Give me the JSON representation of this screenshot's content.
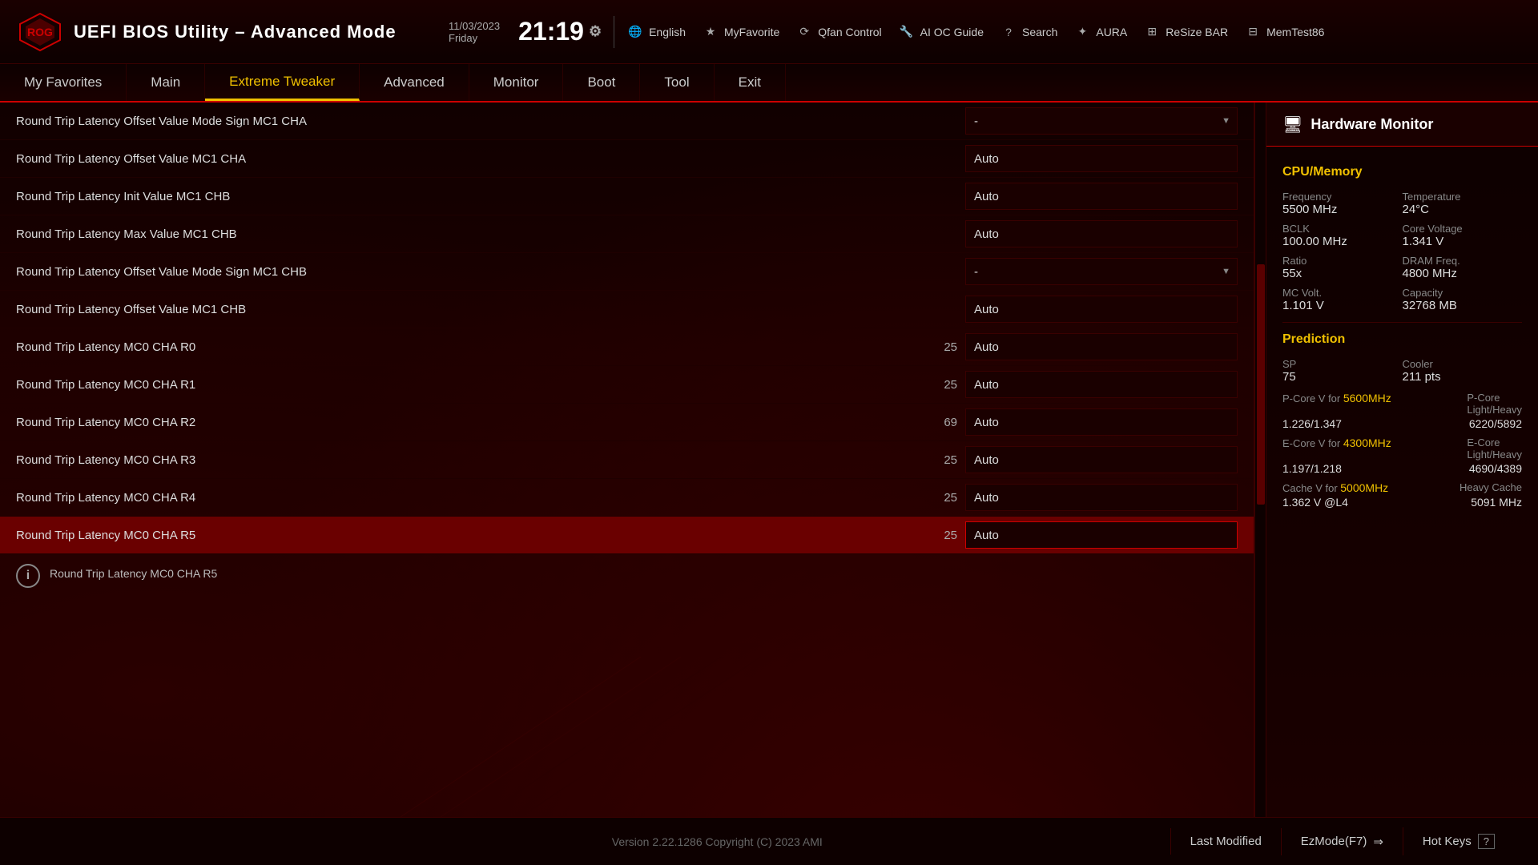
{
  "header": {
    "logo_text": "ROG",
    "title": "UEFI BIOS Utility – Advanced Mode",
    "date": "11/03/2023",
    "day": "Friday",
    "time": "21:19",
    "gear_symbol": "⚙",
    "toolbar": [
      {
        "id": "english",
        "icon": "🌐",
        "label": "English"
      },
      {
        "id": "myfavorite",
        "icon": "★",
        "label": "MyFavorite"
      },
      {
        "id": "qfan",
        "icon": "⟳",
        "label": "Qfan Control"
      },
      {
        "id": "aioc",
        "icon": "🔧",
        "label": "AI OC Guide"
      },
      {
        "id": "search",
        "icon": "?",
        "label": "Search"
      },
      {
        "id": "aura",
        "icon": "✦",
        "label": "AURA"
      },
      {
        "id": "resizebar",
        "icon": "⊞",
        "label": "ReSize BAR"
      },
      {
        "id": "memtest",
        "icon": "⊟",
        "label": "MemTest86"
      }
    ]
  },
  "nav": {
    "items": [
      {
        "id": "favorites",
        "label": "My Favorites"
      },
      {
        "id": "main",
        "label": "Main"
      },
      {
        "id": "tweaker",
        "label": "Extreme Tweaker",
        "active": true
      },
      {
        "id": "advanced",
        "label": "Advanced"
      },
      {
        "id": "monitor",
        "label": "Monitor"
      },
      {
        "id": "boot",
        "label": "Boot"
      },
      {
        "id": "tool",
        "label": "Tool"
      },
      {
        "id": "exit",
        "label": "Exit"
      }
    ]
  },
  "settings": {
    "rows": [
      {
        "id": "row1",
        "label": "Round Trip Latency Offset Value Mode Sign MC1 CHA",
        "number": null,
        "value": "-",
        "type": "dropdown",
        "active": false
      },
      {
        "id": "row2",
        "label": "Round Trip Latency Offset Value MC1 CHA",
        "number": null,
        "value": "Auto",
        "type": "text",
        "active": false
      },
      {
        "id": "row3",
        "label": "Round Trip Latency Init Value MC1 CHB",
        "number": null,
        "value": "Auto",
        "type": "text",
        "active": false
      },
      {
        "id": "row4",
        "label": "Round Trip Latency Max Value MC1 CHB",
        "number": null,
        "value": "Auto",
        "type": "text",
        "active": false
      },
      {
        "id": "row5",
        "label": "Round Trip Latency Offset Value Mode Sign MC1 CHB",
        "number": null,
        "value": "-",
        "type": "dropdown",
        "active": false
      },
      {
        "id": "row6",
        "label": "Round Trip Latency Offset Value MC1 CHB",
        "number": null,
        "value": "Auto",
        "type": "text",
        "active": false
      },
      {
        "id": "row7",
        "label": "Round Trip Latency MC0 CHA R0",
        "number": "25",
        "value": "Auto",
        "type": "text",
        "active": false
      },
      {
        "id": "row8",
        "label": "Round Trip Latency MC0 CHA R1",
        "number": "25",
        "value": "Auto",
        "type": "text",
        "active": false
      },
      {
        "id": "row9",
        "label": "Round Trip Latency MC0 CHA R2",
        "number": "69",
        "value": "Auto",
        "type": "text",
        "active": false
      },
      {
        "id": "row10",
        "label": "Round Trip Latency MC0 CHA R3",
        "number": "25",
        "value": "Auto",
        "type": "text",
        "active": false
      },
      {
        "id": "row11",
        "label": "Round Trip Latency MC0 CHA R4",
        "number": "25",
        "value": "Auto",
        "type": "text",
        "active": false
      },
      {
        "id": "row12",
        "label": "Round Trip Latency MC0 CHA R5",
        "number": "25",
        "value": "Auto",
        "type": "text",
        "active": true
      }
    ],
    "info_text": "Round Trip Latency MC0 CHA R5"
  },
  "hw_monitor": {
    "title": "Hardware Monitor",
    "icon": "🖥",
    "sections": {
      "cpu_memory": {
        "title": "CPU/Memory",
        "items": [
          {
            "label": "Frequency",
            "value": "5500 MHz"
          },
          {
            "label": "Temperature",
            "value": "24°C"
          },
          {
            "label": "BCLK",
            "value": "100.00 MHz"
          },
          {
            "label": "Core Voltage",
            "value": "1.341 V"
          },
          {
            "label": "Ratio",
            "value": "55x"
          },
          {
            "label": "DRAM Freq.",
            "value": "4800 MHz"
          },
          {
            "label": "MC Volt.",
            "value": "1.101 V"
          },
          {
            "label": "Capacity",
            "value": "32768 MB"
          }
        ]
      },
      "prediction": {
        "title": "Prediction",
        "items": [
          {
            "label": "SP",
            "value": "75"
          },
          {
            "label": "Cooler",
            "value": "211 pts"
          },
          {
            "label": "P-Core V for",
            "link": "5600MHz",
            "value2_label": "P-Core",
            "value2": "Light/Heavy"
          },
          {
            "label": "1.226/1.347",
            "value": "6220/5892"
          },
          {
            "label": "E-Core V for",
            "link": "4300MHz",
            "value2_label": "E-Core",
            "value2": "Light/Heavy"
          },
          {
            "label": "1.197/1.218",
            "value": "4690/4389"
          },
          {
            "label": "Cache V for",
            "link": "5000MHz",
            "value2_label": "Heavy Cache",
            "value2": ""
          },
          {
            "label": "1.362 V @L4",
            "value": "5091 MHz"
          }
        ]
      }
    }
  },
  "footer": {
    "version": "Version 2.22.1286 Copyright (C) 2023 AMI",
    "last_modified": "Last Modified",
    "ezmode": "EzMode(F7)",
    "hotkeys": "Hot Keys"
  }
}
